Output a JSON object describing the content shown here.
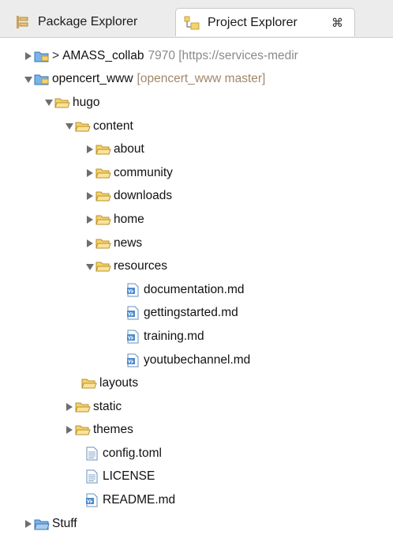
{
  "tabs": {
    "package_explorer": "Package Explorer",
    "project_explorer": "Project Explorer",
    "close_glyph": "⌘"
  },
  "tree": {
    "amass": {
      "prefix": ">",
      "name": "AMASS_collab",
      "extra": "7970 [https://services-medir"
    },
    "opencert": {
      "name": "opencert_www",
      "extra": "[opencert_www master]"
    },
    "hugo": "hugo",
    "content": "content",
    "about": "about",
    "community": "community",
    "downloads": "downloads",
    "home": "home",
    "news": "news",
    "resources": "resources",
    "documentation": "documentation.md",
    "gettingstarted": "gettingstarted.md",
    "training": "training.md",
    "youtubechannel": "youtubechannel.md",
    "layouts": "layouts",
    "static": "static",
    "themes": "themes",
    "config": "config.toml",
    "license": "LICENSE",
    "readme": "README.md",
    "stuff": "Stuff"
  },
  "colors": {
    "folder_fill": "#f6d36a",
    "folder_stroke": "#b8902a",
    "project_fill": "#7bb3e6",
    "project_stroke": "#3a74b5",
    "link_gray": "#8a8a8a"
  }
}
